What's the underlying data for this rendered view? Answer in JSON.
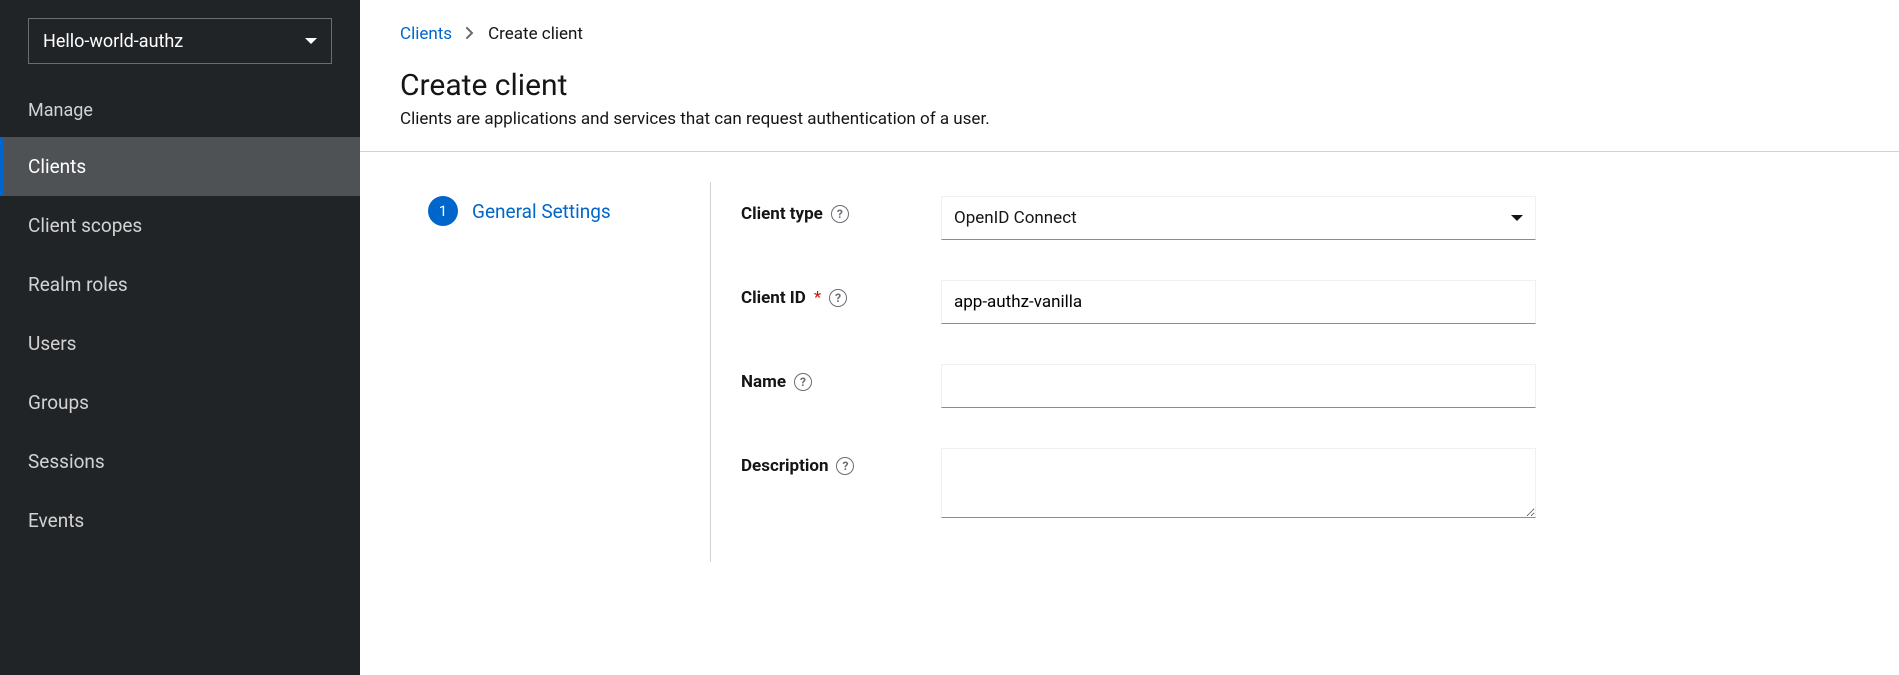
{
  "sidebar": {
    "realm_selector": {
      "value": "Hello-world-authz"
    },
    "section_label": "Manage",
    "items": [
      {
        "label": "Clients",
        "active": true
      },
      {
        "label": "Client scopes",
        "active": false
      },
      {
        "label": "Realm roles",
        "active": false
      },
      {
        "label": "Users",
        "active": false
      },
      {
        "label": "Groups",
        "active": false
      },
      {
        "label": "Sessions",
        "active": false
      },
      {
        "label": "Events",
        "active": false
      }
    ]
  },
  "breadcrumb": {
    "parent": "Clients",
    "current": "Create client"
  },
  "page": {
    "title": "Create client",
    "subtitle": "Clients are applications and services that can request authentication of a user."
  },
  "wizard": {
    "step1": {
      "number": "1",
      "label": "General Settings"
    }
  },
  "form": {
    "client_type": {
      "label": "Client type",
      "value": "OpenID Connect"
    },
    "client_id": {
      "label": "Client ID",
      "value": "app-authz-vanilla"
    },
    "name": {
      "label": "Name",
      "value": ""
    },
    "description": {
      "label": "Description",
      "value": ""
    }
  },
  "glyphs": {
    "required": "*",
    "help": "?"
  }
}
